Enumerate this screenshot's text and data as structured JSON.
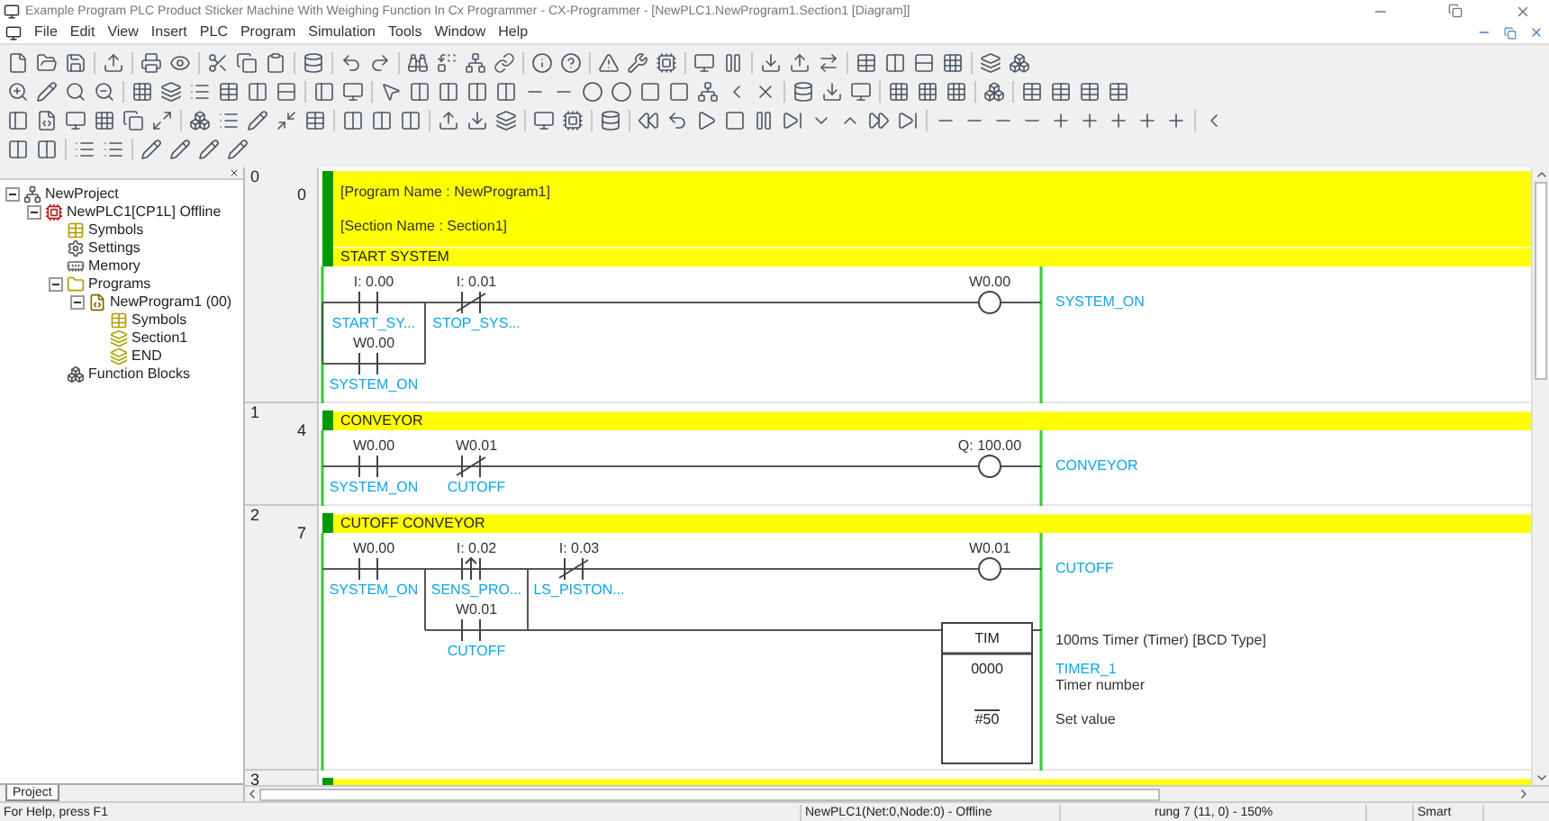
{
  "window": {
    "title": "Example Program PLC Product Sticker Machine With Weighing Function In Cx Programmer - CX-Programmer - [NewPLC1.NewProgram1.Section1 [Diagram]]"
  },
  "menu": [
    "File",
    "Edit",
    "View",
    "Insert",
    "PLC",
    "Program",
    "Simulation",
    "Tools",
    "Window",
    "Help"
  ],
  "project_tree": [
    {
      "label": "NewProject",
      "kind": "project",
      "expanded": true,
      "children": [
        {
          "label": "NewPLC1[CP1L] Offline",
          "kind": "plc",
          "expanded": true,
          "children": [
            {
              "label": "Symbols",
              "kind": "symbols"
            },
            {
              "label": "Settings",
              "kind": "settings"
            },
            {
              "label": "Memory",
              "kind": "memory"
            },
            {
              "label": "Programs",
              "kind": "programs",
              "expanded": true,
              "children": [
                {
                  "label": "NewProgram1 (00)",
                  "kind": "program",
                  "expanded": true,
                  "children": [
                    {
                      "label": "Symbols",
                      "kind": "symbols"
                    },
                    {
                      "label": "Section1",
                      "kind": "section"
                    },
                    {
                      "label": "END",
                      "kind": "section"
                    }
                  ]
                }
              ]
            },
            {
              "label": "Function Blocks",
              "kind": "blocks"
            }
          ]
        }
      ]
    }
  ],
  "panel_tabs": [
    {
      "label": "Project",
      "selected": true
    }
  ],
  "rungs": [
    {
      "number": "0",
      "step": "0",
      "header": [
        "[Program Name : NewProgram1]",
        "[Section Name : Section1]"
      ],
      "comment": "START SYSTEM",
      "series": [
        {
          "kind": "parallel",
          "branches": [
            [
              {
                "kind": "contact_no",
                "address": "I: 0.00",
                "symbol": "START_SY..."
              }
            ],
            [
              {
                "kind": "contact_no",
                "address": "W0.00",
                "symbol": "SYSTEM_ON"
              }
            ]
          ]
        },
        {
          "kind": "contact_nc",
          "address": "I: 0.01",
          "symbol": "STOP_SYS..."
        }
      ],
      "output": {
        "kind": "coil",
        "address": "W0.00",
        "symbol": "SYSTEM_ON"
      }
    },
    {
      "number": "1",
      "step": "4",
      "comment": "CONVEYOR",
      "series": [
        {
          "kind": "contact_no",
          "address": "W0.00",
          "symbol": "SYSTEM_ON"
        },
        {
          "kind": "contact_nc",
          "address": "W0.01",
          "symbol": "CUTOFF"
        }
      ],
      "output": {
        "kind": "coil",
        "address": "Q: 100.00",
        "symbol": "CONVEYOR"
      }
    },
    {
      "number": "2",
      "step": "7",
      "comment": "CUTOFF CONVEYOR",
      "series": [
        {
          "kind": "contact_no",
          "address": "W0.00",
          "symbol": "SYSTEM_ON"
        },
        {
          "kind": "parallel",
          "branches": [
            [
              {
                "kind": "contact_rise",
                "address": "I: 0.02",
                "symbol": "SENS_PRO..."
              }
            ],
            [
              {
                "kind": "contact_no",
                "address": "W0.01",
                "symbol": "CUTOFF"
              }
            ]
          ],
          "tap_output": {
            "kind": "timer",
            "name": "TIM",
            "description": "100ms Timer (Timer) [BCD Type]",
            "operands": [
              {
                "value": "0000",
                "symbol": "TIMER_1",
                "note": "Timer number"
              },
              {
                "value": "#50",
                "note": "Set value"
              }
            ]
          }
        },
        {
          "kind": "contact_nc",
          "address": "I: 0.03",
          "symbol": "LS_PISTON..."
        }
      ],
      "output": {
        "kind": "coil",
        "address": "W0.01",
        "symbol": "CUTOFF"
      }
    },
    {
      "number": "3"
    }
  ],
  "status_bar": [
    "For Help, press F1",
    "NewPLC1(Net:0,Node:0) - Offline",
    "rung 7 (11, 0)  - 150%",
    "Smart"
  ]
}
